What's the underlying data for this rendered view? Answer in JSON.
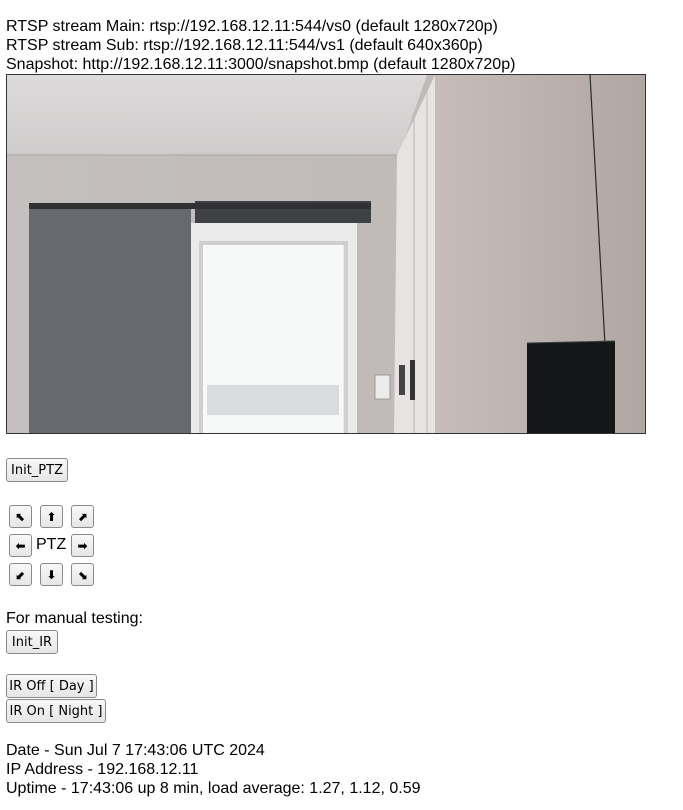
{
  "streams": {
    "main": "RTSP stream Main: rtsp://192.168.12.11:544/vs0 (default 1280x720p)",
    "sub": "RTSP stream Sub: rtsp://192.168.12.11:544/vs1 (default 640x360p)",
    "snapshot": "Snapshot: http://192.168.12.11:3000/snapshot.bmp (default 1280x720p)"
  },
  "buttons": {
    "init_ptz": "Init_PTZ",
    "init_ir": "Init_IR",
    "ir_off": "IR Off [ Day ]",
    "ir_on": "IR On [ Night ]"
  },
  "ptz": {
    "label": "PTZ",
    "up_left": "⬉",
    "up": "⬆",
    "up_right": "⬈",
    "left": "⬅",
    "right": "➡",
    "down_left": "⬋",
    "down": "⬇",
    "down_right": "⬊"
  },
  "manual_testing_label": "For manual testing:",
  "status": {
    "date": "Date - Sun Jul 7 17:43:06 UTC 2024",
    "ip": "IP Address - 192.168.12.11",
    "uptime": "Uptime - 17:43:06 up 8 min, load average: 1.27, 1.12, 0.59"
  }
}
